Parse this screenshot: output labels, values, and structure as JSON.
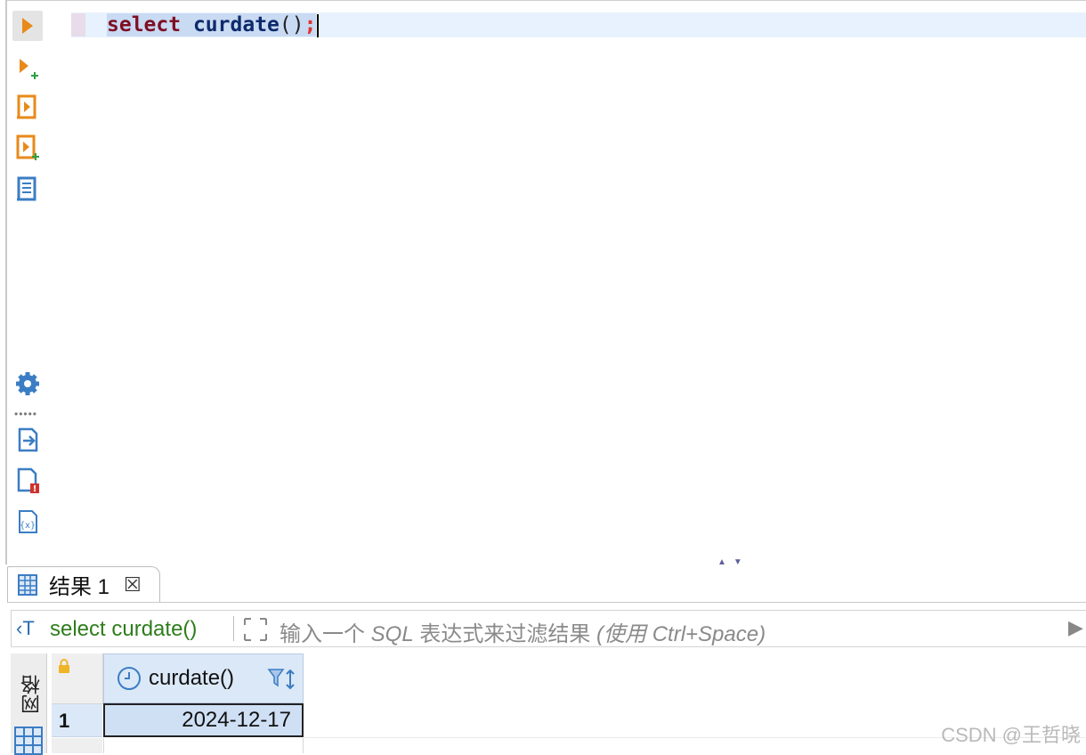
{
  "toolbar": {
    "items": [
      {
        "name": "execute-statement-icon"
      },
      {
        "name": "execute-statement-new-tab-icon"
      },
      {
        "name": "execute-script-icon"
      },
      {
        "name": "execute-script-new-tab-icon"
      },
      {
        "name": "explain-plan-icon"
      },
      {
        "name": "settings-gear-icon"
      },
      {
        "name": "export-icon"
      },
      {
        "name": "problems-icon"
      },
      {
        "name": "variables-icon"
      }
    ]
  },
  "editor": {
    "keyword": "select",
    "function": "curdate",
    "parens": "()",
    "terminator": ";"
  },
  "results": {
    "tab_label": "结果 1",
    "tab_close": "☒",
    "filter": {
      "query_text": "select curdate()",
      "placeholder_prefix": "输入一个 ",
      "placeholder_sql": "SQL",
      "placeholder_mid": " 表达式来过滤结果 ",
      "placeholder_hint": "(使用 Ctrl+Space)"
    },
    "side_tab_label": "网格",
    "columns": [
      "curdate()"
    ],
    "rows": [
      {
        "num": "1",
        "values": [
          "2024-12-17"
        ]
      }
    ]
  },
  "watermark": "CSDN @王哲晓",
  "colors": {
    "accent_orange": "#e88a1a",
    "accent_blue": "#3b7dc4",
    "selection": "#c9daf3",
    "filter_green": "#2e7d1c"
  }
}
